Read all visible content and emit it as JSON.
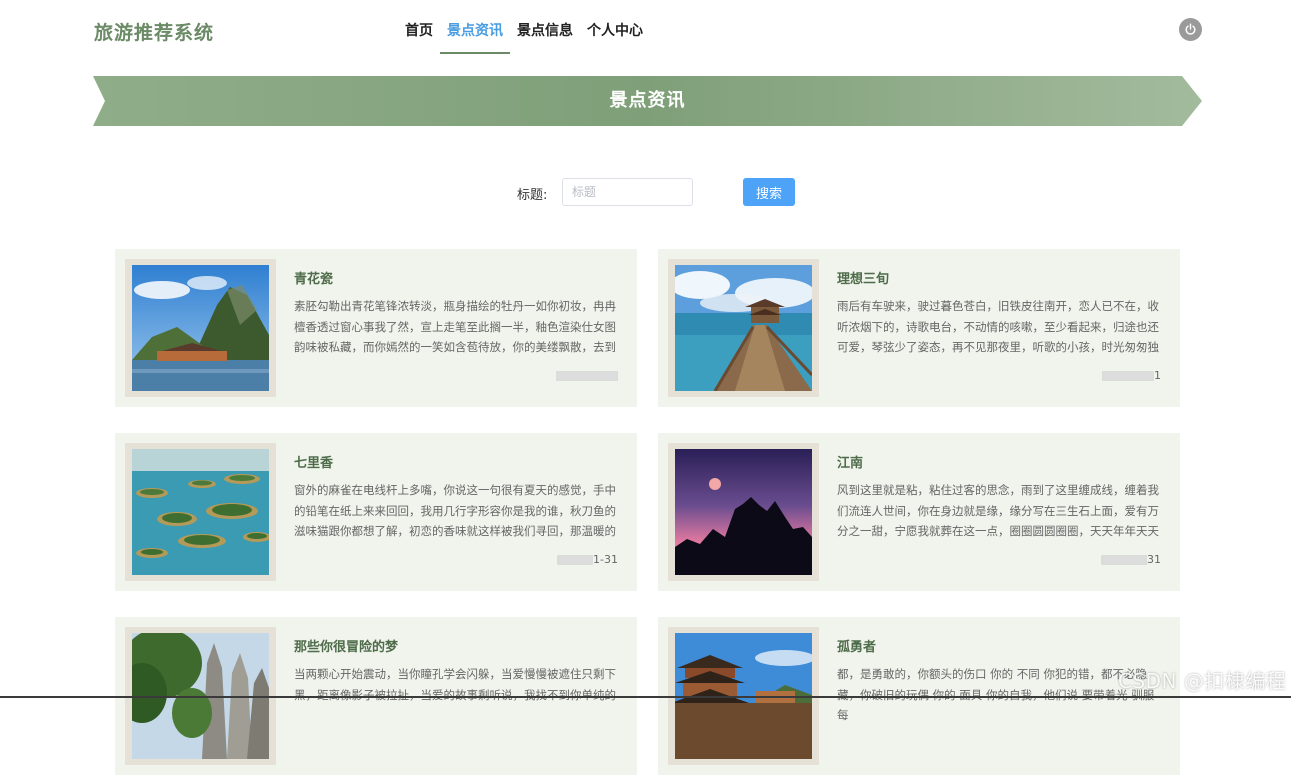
{
  "app": {
    "title": "旅游推荐系统"
  },
  "nav": {
    "items": [
      {
        "label": "首页",
        "active": false
      },
      {
        "label": "景点资讯",
        "active": true
      },
      {
        "label": "景点信息",
        "active": false
      },
      {
        "label": "个人中心",
        "active": false
      }
    ]
  },
  "banner": {
    "title": "景点资讯"
  },
  "search": {
    "label": "标题:",
    "placeholder": "标题",
    "value": "",
    "button": "搜索"
  },
  "colors": {
    "brand": "#6b8a66",
    "accent": "#4da3f7",
    "card_bg": "#f0f4ec",
    "banner": "#94b08e"
  },
  "articles": [
    {
      "title": "青花瓷",
      "text": "素胚勾勒出青花笔锋浓转淡，瓶身描绘的牡丹一如你初妆，冉冉檀香透过窗心事我了然，宣上走笔至此搁一半，釉色渲染仕女图韵味被私藏，而你嫣然的一笑如含苞待放，你的美缕飘散，去到",
      "date": "",
      "image": "karst-mountain-lake"
    },
    {
      "title": "理想三旬",
      "text": "雨后有车驶来，驶过暮色苍白，旧铁皮往南开，恋人已不在，收听浓烟下的，诗歌电台，不动情的咳嗽，至少看起来，归途也还可爱，琴弦少了姿态，再不见那夜里，听歌的小孩，时光匆匆独",
      "date": "1",
      "image": "pier-pavilion-sea"
    },
    {
      "title": "七里香",
      "text": "窗外的麻雀在电线杆上多嘴，你说这一句很有夏天的感觉，手中的铅笔在纸上来来回回，我用几行字形容你是我的谁，秋刀鱼的滋味猫跟你都想了解，初恋的香味就这样被我们寻回，那温暖的",
      "date": "1-31",
      "image": "island-lake"
    },
    {
      "title": "江南",
      "text": "风到这里就是粘，粘住过客的思念，雨到了这里缠成线，缠着我们流连人世间，你在身边就是缘，缘分写在三生石上面，爱有万分之一甜，宁愿我就葬在这一点，圈圈圆圆圈圈，天天年年天天",
      "date": "31",
      "image": "pink-sunset-silhouette"
    },
    {
      "title": "那些你很冒险的梦",
      "text": "当两颗心开始震动，当你瞳孔学会闪躲，当爱慢慢被遮住只剩下黑，距离像影子被拉扯，当爱的故事剩听说，我找不到你单纯的",
      "date": "",
      "image": "stone-forest"
    },
    {
      "title": "孤勇者",
      "text": "都，是勇敢的，你额头的伤口 你的 不同 你犯的错，都不必隐藏，你破旧的玩偶 你的 面具 你的自我，他们说 要带着光 驯服每",
      "date": "",
      "image": "temple-pagoda"
    }
  ],
  "watermark": "CSDN @扣棣编程"
}
